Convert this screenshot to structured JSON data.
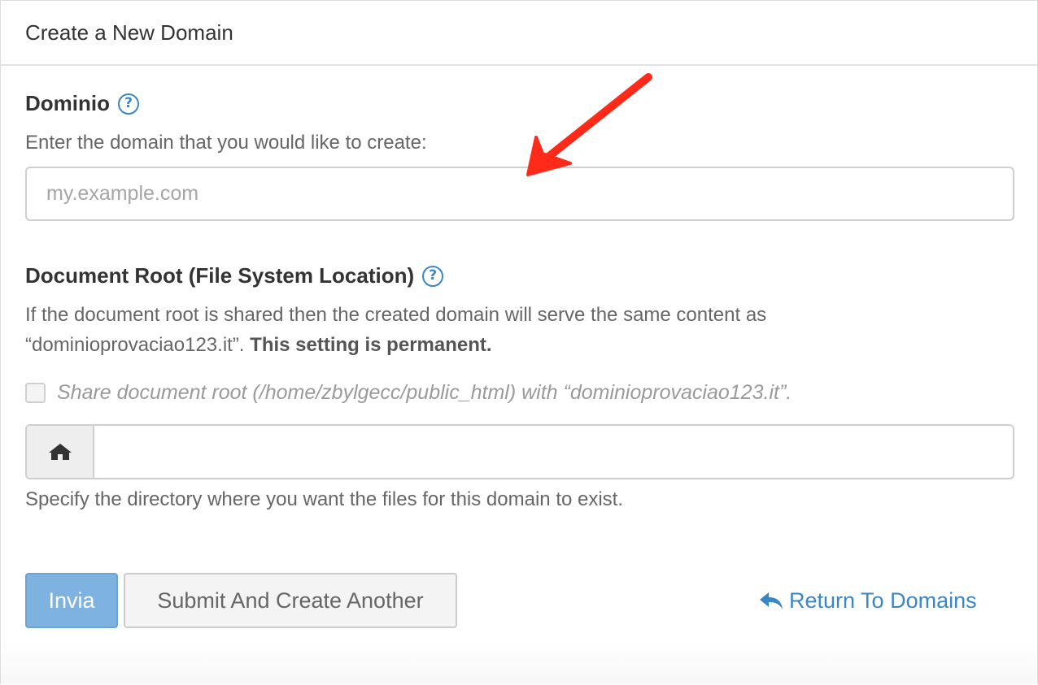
{
  "panel": {
    "title": "Create a New Domain"
  },
  "domain_section": {
    "label": "Dominio",
    "description": "Enter the domain that you would like to create:",
    "input_placeholder": "my.example.com",
    "input_value": ""
  },
  "docroot_section": {
    "label": "Document Root (File System Location)",
    "description_line1": "If the document root is shared then the created domain will serve the same content as",
    "description_line2_prefix": "“dominioprovaciao123.it”.",
    "description_line2_bold": "This setting is permanent.",
    "share_checkbox_label": "Share document root (/home/zbylgecc/public_html) with “dominioprovaciao123.it”.",
    "share_checked": false,
    "path_input_value": "",
    "help_text": "Specify the directory where you want the files for this domain to exist.",
    "addon_icon": "home-icon"
  },
  "actions": {
    "submit_label": "Invia",
    "submit_another_label": "Submit And Create Another",
    "return_label": "Return To Domains",
    "return_icon": "reply-icon"
  },
  "help_icon_glyph": "?",
  "annotation": {
    "type": "red-arrow",
    "color": "#ff2a1a"
  },
  "colors": {
    "link": "#3a87c8",
    "primary_button": "#7eb2e0",
    "annotation_arrow": "#ff2a1a"
  }
}
